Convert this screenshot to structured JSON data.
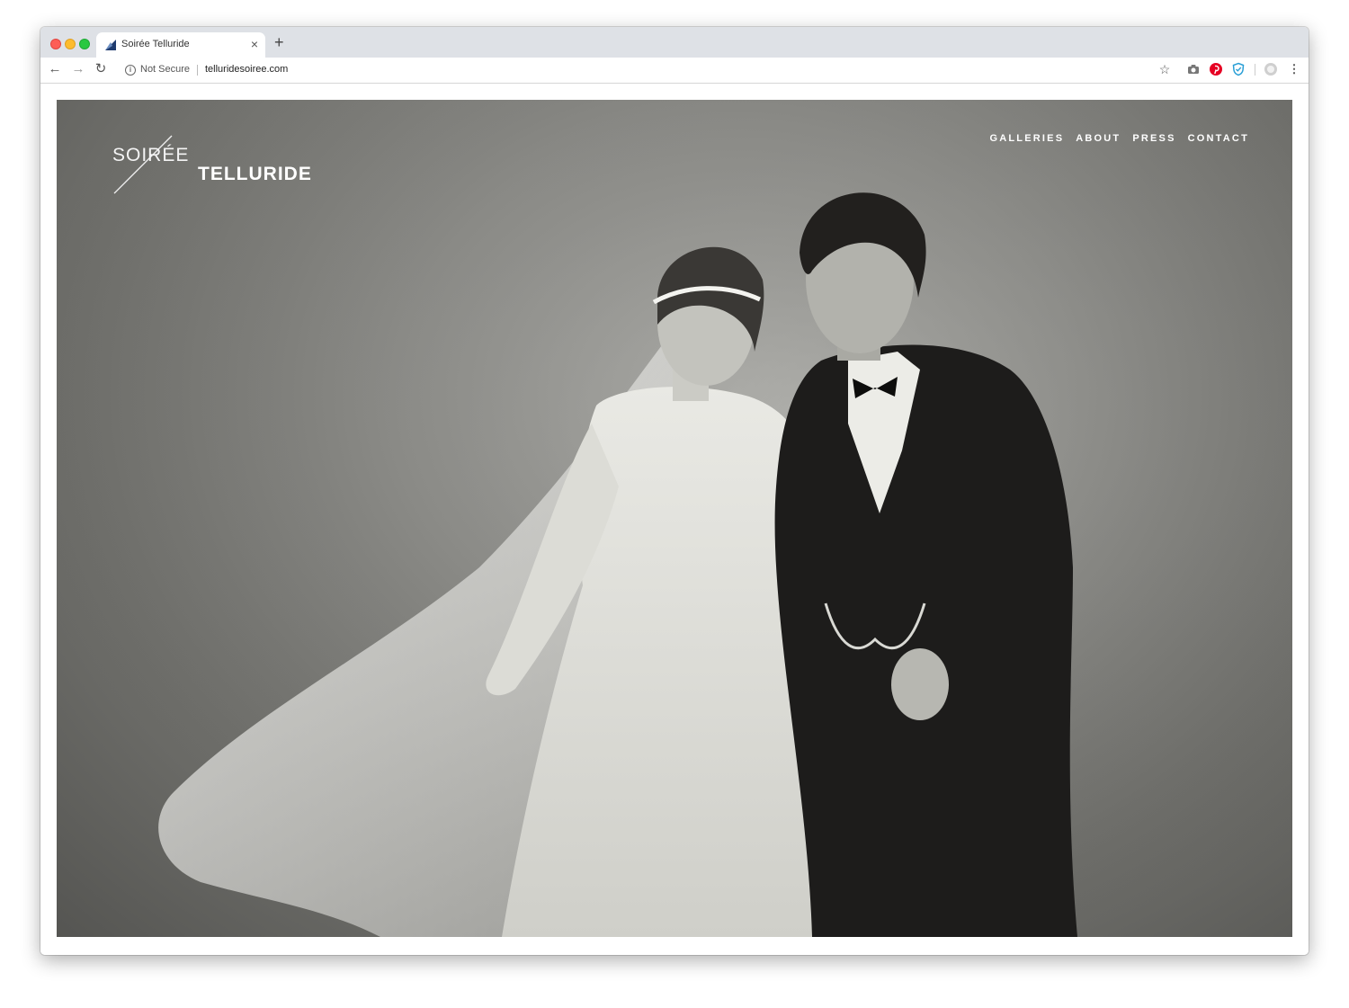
{
  "browser": {
    "tab": {
      "title": "Soirée Telluride",
      "close": "×"
    },
    "new_tab": "+",
    "toolbar": {
      "back": "←",
      "forward": "→",
      "reload": "↻",
      "security_label": "Not Secure",
      "url": "telluridesoiree.com",
      "bookmark": "☆",
      "menu": "⋮"
    },
    "extension_icons": [
      "camera-icon",
      "pinterest-icon",
      "shield-icon",
      "profile-icon"
    ],
    "colors": {
      "pinterest": "#e60023",
      "shield": "#2a9fd6"
    }
  },
  "site": {
    "logo": {
      "word1": "SOIRÉE",
      "word2": "TELLURIDE"
    },
    "nav": [
      {
        "label": "GALLERIES"
      },
      {
        "label": "ABOUT"
      },
      {
        "label": "PRESS"
      },
      {
        "label": "CONTACT"
      }
    ],
    "hero_photo": "black-and-white portrait of a bride in lace gown and veil beside a groom in tuxedo"
  }
}
